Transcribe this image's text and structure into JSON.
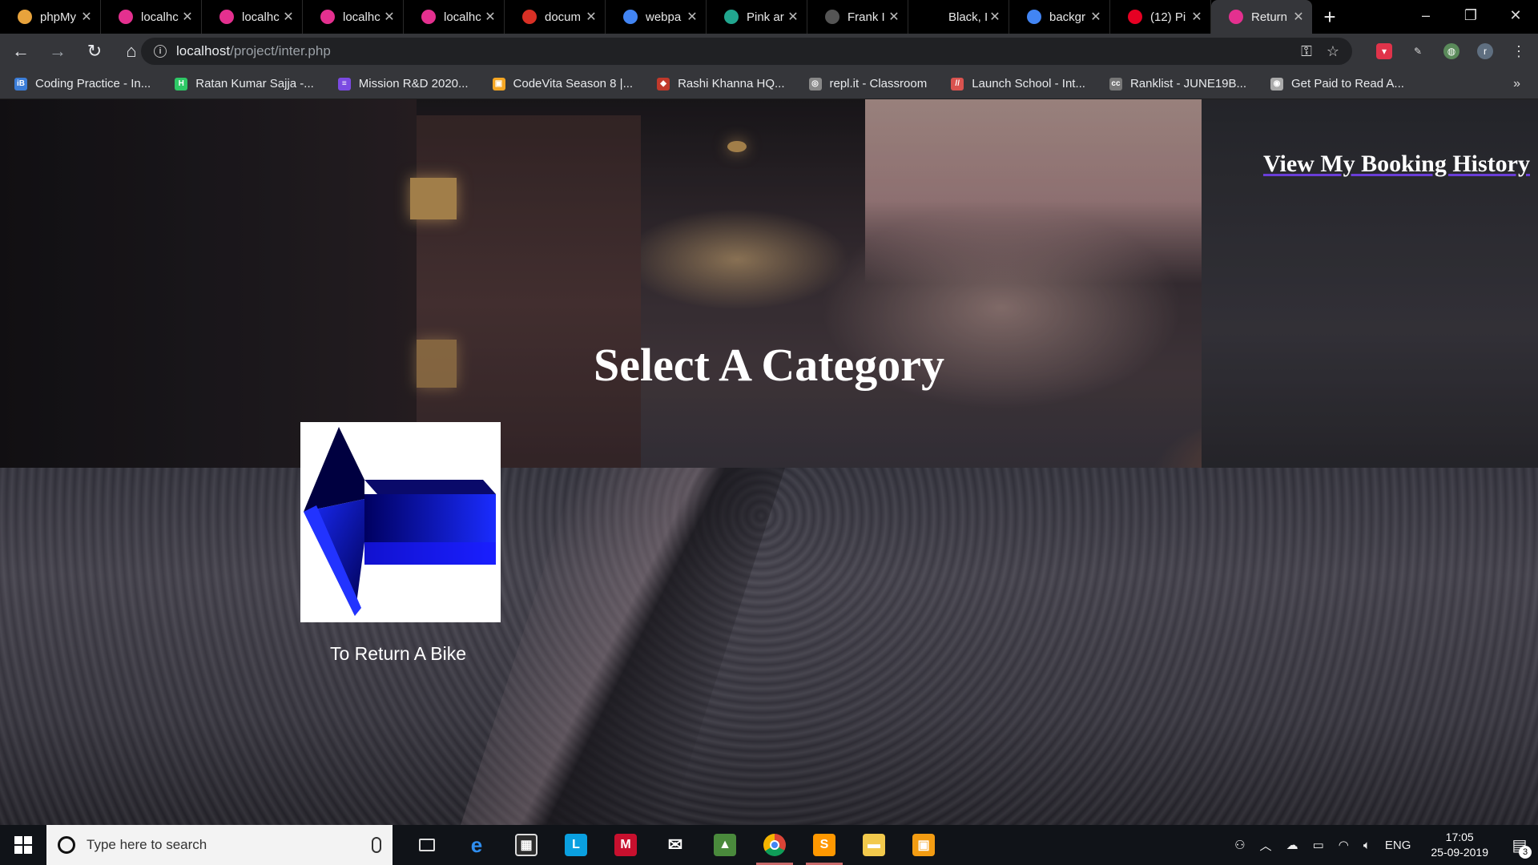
{
  "browser": {
    "tabs": [
      {
        "title": "phpMy",
        "favicon_color": "#e8a33c",
        "active": false
      },
      {
        "title": "localhc",
        "favicon_color": "#e4308f",
        "active": false
      },
      {
        "title": "localhc",
        "favicon_color": "#e4308f",
        "active": false
      },
      {
        "title": "localhc",
        "favicon_color": "#e4308f",
        "active": false
      },
      {
        "title": "localhc",
        "favicon_color": "#e4308f",
        "active": false
      },
      {
        "title": "docum",
        "favicon_color": "#d93025",
        "active": false
      },
      {
        "title": "webpa",
        "favicon_color": "#4285f4",
        "active": false
      },
      {
        "title": "Pink ar",
        "favicon_color": "#21a68f",
        "active": false
      },
      {
        "title": "Frank I",
        "favicon_color": "#555555",
        "active": false
      },
      {
        "title": "Black, I",
        "favicon_color": "#000000",
        "active": false
      },
      {
        "title": "backgr",
        "favicon_color": "#4285f4",
        "active": false
      },
      {
        "title": "(12) Pi",
        "favicon_color": "#e60023",
        "active": false
      },
      {
        "title": "Return",
        "favicon_color": "#e4308f",
        "active": true
      }
    ],
    "new_tab_label": "+",
    "address": {
      "host": "localhost",
      "path": "/project/inter.php"
    },
    "bookmarks": [
      {
        "label": "Coding Practice - In...",
        "icon_color": "#3b7dd8"
      },
      {
        "label": "Ratan Kumar Sajja -...",
        "icon_color": "#2ec866"
      },
      {
        "label": "Mission R&D 2020...",
        "icon_color": "#7b4ae2"
      },
      {
        "label": "CodeVita Season 8 |...",
        "icon_color": "#f5a623"
      },
      {
        "label": "Rashi Khanna HQ...",
        "icon_color": "#c0392b"
      },
      {
        "label": "repl.it - Classroom",
        "icon_color": "#888888"
      },
      {
        "label": "Launch School - Int...",
        "icon_color": "#d9534f"
      },
      {
        "label": "Ranklist - JUNE19B...",
        "icon_color": "#777777"
      },
      {
        "label": "Get Paid to Read A...",
        "icon_color": "#aaaaaa"
      }
    ],
    "bookmarks_more": "»"
  },
  "page": {
    "history_link": "View My Booking History",
    "title": "Select A Category",
    "categories": [
      {
        "label": "To Return A Bike",
        "icon": "left-arrow-icon"
      }
    ]
  },
  "taskbar": {
    "search_placeholder": "Type here to search",
    "language": "ENG",
    "time": "17:05",
    "date": "25-09-2019",
    "notification_count": "3"
  }
}
